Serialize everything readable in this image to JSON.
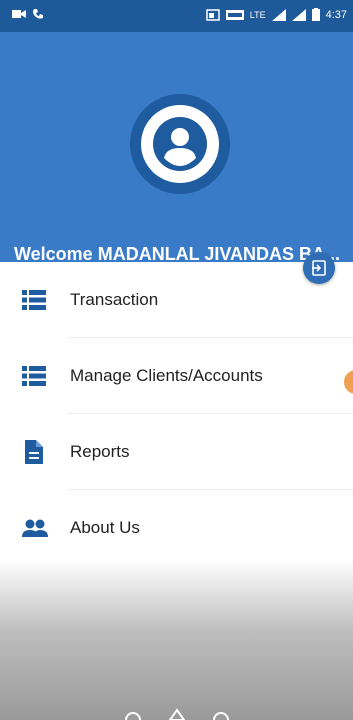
{
  "status_bar": {
    "time": "4:37",
    "network": "LTE"
  },
  "drawer": {
    "welcome_text": "Welcome MADANLAL JIVANDAS BA...",
    "menu": [
      {
        "label": "Transaction",
        "icon": "list-icon"
      },
      {
        "label": "Manage Clients/Accounts",
        "icon": "list-icon"
      },
      {
        "label": "Reports",
        "icon": "document-icon"
      },
      {
        "label": "About Us",
        "icon": "people-icon"
      }
    ]
  },
  "colors": {
    "header": "#3a7bc8",
    "status_bar": "#1e5a9a",
    "icon": "#1f5b9f"
  }
}
